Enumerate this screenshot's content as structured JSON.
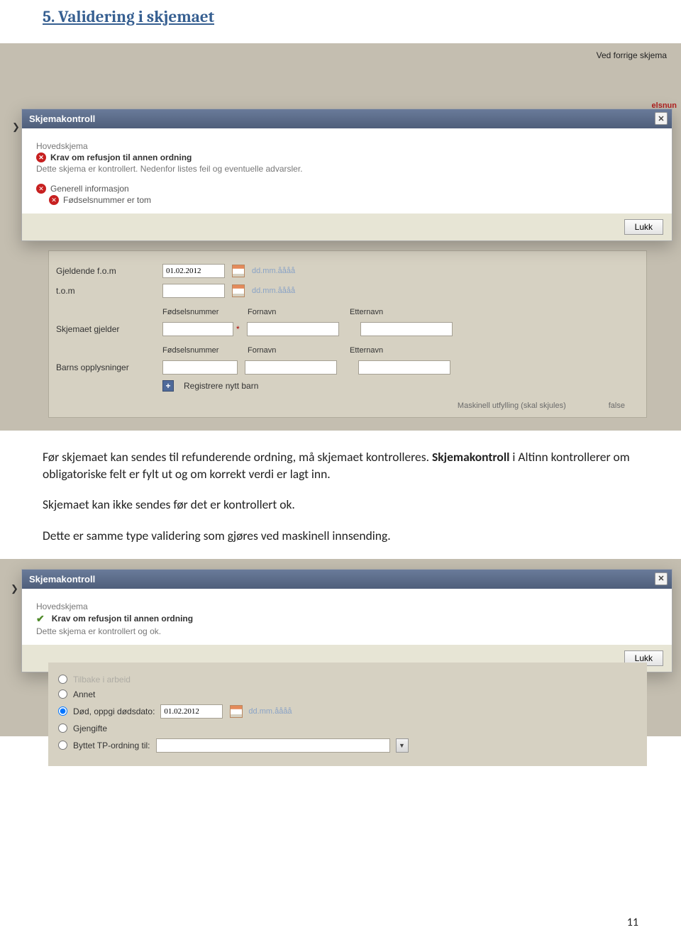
{
  "heading": "5. Validering i skjemaet",
  "bg_cut_text": "Ved forrige skjema",
  "red_cut_text": "elsnun",
  "x_cut": "❯",
  "dialog1": {
    "title": "Skjemakontroll",
    "close": "✕",
    "sub_title": "Hovedskjema",
    "row_bold": "Krav om refusjon til annen ordning",
    "desc": "Dette skjema er kontrollert. Nedenfor listes feil og eventuelle advarsler.",
    "err1": "Generell informasjon",
    "err2": "Fødselsnummer er tom",
    "lukk": "Lukk"
  },
  "form": {
    "row1_label": "Gjeldende f.o.m",
    "row1_value": "01.02.2012",
    "date_hint": "dd.mm.åååå",
    "row2_label": "t.o.m",
    "row3_label": "Skjemaet gjelder",
    "row4_label": "Barns opplysninger",
    "col_fn": "Fødselsnummer",
    "col_given": "Fornavn",
    "col_last": "Etternavn",
    "reg_link": "Registrere nytt barn",
    "mask_label": "Maskinell utfylling (skal skjules)",
    "mask_val": "false",
    "asterisk": "*"
  },
  "body": {
    "p1a": "Før skjemaet kan sendes til refunderende ordning, må skjemaet kontrolleres. ",
    "p1b": "Skjemakontroll",
    "p1c": " i Altinn kontrollerer om obligatoriske felt er fylt ut og om korrekt verdi er lagt inn.",
    "p2": "Skjemaet kan ikke sendes før det er kontrollert ok.",
    "p3": "Dette er samme type validering som gjøres ved maskinell innsending."
  },
  "dialog2": {
    "title": "Skjemakontroll",
    "close": "✕",
    "sub_title": "Hovedskjema",
    "row_bold": "Krav om refusjon til annen ordning",
    "desc": "Dette skjema er kontrollert og ok.",
    "lukk": "Lukk"
  },
  "radio": {
    "opt1_partial": "Tilbake i arbeid",
    "opt2": "Annet",
    "opt3_label": "Død, oppgi dødsdato:",
    "opt3_value": "01.02.2012",
    "opt4": "Gjengifte",
    "opt5": "Byttet TP-ordning til:",
    "date_hint": "dd.mm.åååå"
  },
  "page_num": "11"
}
